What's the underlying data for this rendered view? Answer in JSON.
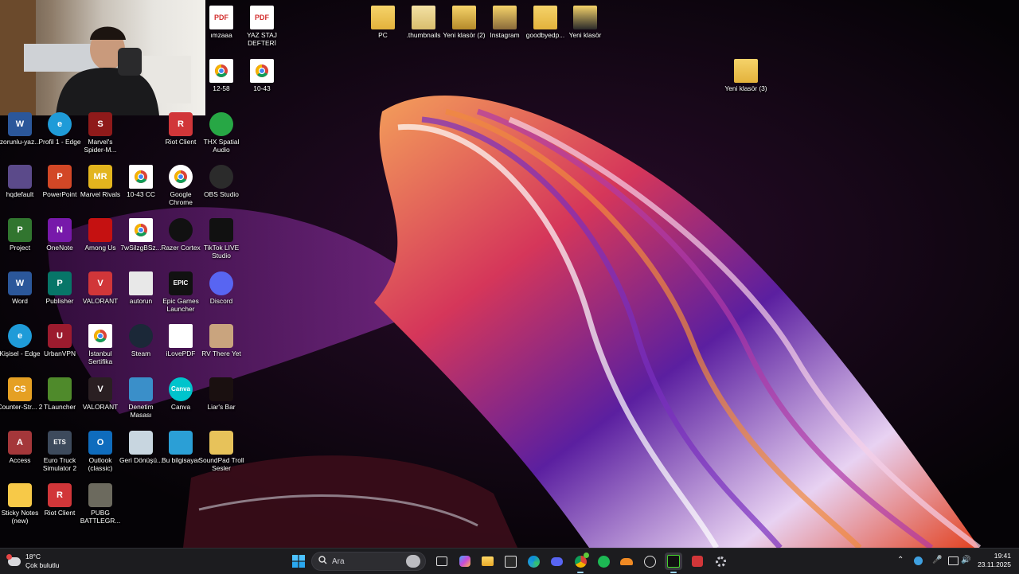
{
  "desktop": {
    "top_icons": [
      {
        "label": "ımzaaa",
        "icon": "pdf-icon"
      },
      {
        "label": "YAZ STAJ DEFTERİ",
        "icon": "pdf-icon"
      },
      {
        "label": "12-58",
        "icon": "chrome-file-icon"
      },
      {
        "label": "10-43",
        "icon": "chrome-file-icon"
      }
    ],
    "folders": [
      {
        "label": "PC"
      },
      {
        "label": ".thumbnails"
      },
      {
        "label": "Yeni klasör (2)"
      },
      {
        "label": "Instagram"
      },
      {
        "label": "goodbyedp..."
      },
      {
        "label": "Yeni klasör"
      },
      {
        "label": "Yeni klasör (3)"
      }
    ],
    "grid": [
      [
        {
          "label": "zorunlu-yaz...",
          "icon": "word-icon",
          "color": "#2b579a",
          "glyph": "W"
        },
        {
          "label": "hqdefault",
          "icon": "image-icon",
          "color": "#5b4a8a",
          "glyph": ""
        },
        {
          "label": "Project",
          "icon": "project-icon",
          "color": "#31752f",
          "glyph": "P"
        },
        {
          "label": "Word",
          "icon": "word-icon",
          "color": "#2b579a",
          "glyph": "W"
        },
        {
          "label": "Kişisel - Edge",
          "icon": "edge-icon",
          "color": "#1f9bd8",
          "glyph": "e"
        },
        {
          "label": "Counter-Str... 2",
          "icon": "cs2-icon",
          "color": "#e5a023",
          "glyph": "CS"
        },
        {
          "label": "Access",
          "icon": "access-icon",
          "color": "#a4373a",
          "glyph": "A"
        },
        {
          "label": "Sticky Notes (new)",
          "icon": "sticky-notes-icon",
          "color": "#f7c948",
          "glyph": ""
        }
      ],
      [
        {
          "label": "Profil 1 - Edge",
          "icon": "edge-icon",
          "color": "#1f9bd8",
          "glyph": "e"
        },
        {
          "label": "PowerPoint",
          "icon": "powerpoint-icon",
          "color": "#d24726",
          "glyph": "P"
        },
        {
          "label": "OneNote",
          "icon": "onenote-icon",
          "color": "#7719aa",
          "glyph": "N"
        },
        {
          "label": "Publisher",
          "icon": "publisher-icon",
          "color": "#077568",
          "glyph": "P"
        },
        {
          "label": "UrbanVPN",
          "icon": "urbanvpn-icon",
          "color": "#9c1b2e",
          "glyph": "U"
        },
        {
          "label": "TLauncher",
          "icon": "tlauncher-icon",
          "color": "#4f8a2b",
          "glyph": ""
        },
        {
          "label": "Euro Truck Simulator 2",
          "icon": "ets2-icon",
          "color": "#3d4a5c",
          "glyph": "ETS"
        },
        {
          "label": "Riot Client",
          "icon": "riot-icon",
          "color": "#d13639",
          "glyph": "R"
        }
      ],
      [
        {
          "label": "Marvel's Spider-M...",
          "icon": "spiderman-icon",
          "color": "#8f1a1a",
          "glyph": "S"
        },
        {
          "label": "Marvel Rivals",
          "icon": "marvel-rivals-icon",
          "color": "#e3b51e",
          "glyph": "MR"
        },
        {
          "label": "Among Us",
          "icon": "among-us-icon",
          "color": "#c51111",
          "glyph": ""
        },
        {
          "label": "VALORANT",
          "icon": "riot-icon",
          "color": "#d13639",
          "glyph": "V"
        },
        {
          "label": "İstanbul Sertifika",
          "icon": "chrome-file-icon",
          "color": "#ffffff",
          "glyph": ""
        },
        {
          "label": "VALORANT",
          "icon": "valorant-icon",
          "color": "#2a1f22",
          "glyph": "V"
        },
        {
          "label": "Outlook (classic)",
          "icon": "outlook-icon",
          "color": "#0f6cbd",
          "glyph": "O"
        },
        {
          "label": "PUBG BATTLEGR...",
          "icon": "pubg-icon",
          "color": "#6c6a5e",
          "glyph": ""
        }
      ],
      [
        {
          "label": "",
          "icon": "",
          "color": "",
          "glyph": ""
        },
        {
          "label": "10-43 CC",
          "icon": "chrome-file-icon",
          "color": "#ffffff",
          "glyph": ""
        },
        {
          "label": "7wSilzgBSz...",
          "icon": "chrome-file-icon",
          "color": "#ffffff",
          "glyph": ""
        },
        {
          "label": "autorun",
          "icon": "settings-file-icon",
          "color": "#e8e8e8",
          "glyph": ""
        },
        {
          "label": "Steam",
          "icon": "steam-icon",
          "color": "#1b2838",
          "glyph": ""
        },
        {
          "label": "Denetim Masası",
          "icon": "control-panel-icon",
          "color": "#3a8fc9",
          "glyph": ""
        },
        {
          "label": "Geri Dönüşü...",
          "icon": "recycle-bin-icon",
          "color": "#c8d6e0",
          "glyph": ""
        },
        {
          "label": "",
          "icon": "",
          "color": "",
          "glyph": ""
        }
      ],
      [
        {
          "label": "Riot Client",
          "icon": "riot-icon",
          "color": "#d13639",
          "glyph": "R"
        },
        {
          "label": "Google Chrome",
          "icon": "chrome-icon",
          "color": "#ffffff",
          "glyph": ""
        },
        {
          "label": "Razer Cortex",
          "icon": "razer-icon",
          "color": "#111111",
          "glyph": ""
        },
        {
          "label": "Epic Games Launcher",
          "icon": "epic-games-icon",
          "color": "#111111",
          "glyph": "EPIC"
        },
        {
          "label": "iLovePDF",
          "icon": "blank-file-icon",
          "color": "#ffffff",
          "glyph": ""
        },
        {
          "label": "Canva",
          "icon": "canva-icon",
          "color": "#00c4cc",
          "glyph": "Canva"
        },
        {
          "label": "Bu bilgisayar",
          "icon": "this-pc-icon",
          "color": "#2b9fd6",
          "glyph": ""
        },
        {
          "label": "",
          "icon": "",
          "color": "",
          "glyph": ""
        }
      ],
      [
        {
          "label": "THX Spatial Audio",
          "icon": "thx-icon",
          "color": "#27a745",
          "glyph": ""
        },
        {
          "label": "OBS Studio",
          "icon": "obs-icon",
          "color": "#2b2b2b",
          "glyph": ""
        },
        {
          "label": "TikTok LIVE Studio",
          "icon": "tiktok-icon",
          "color": "#111111",
          "glyph": ""
        },
        {
          "label": "Discord",
          "icon": "discord-icon",
          "color": "#5865f2",
          "glyph": ""
        },
        {
          "label": "RV There Yet",
          "icon": "rv-there-yet-icon",
          "color": "#c9a47e",
          "glyph": ""
        },
        {
          "label": "Liar's Bar",
          "icon": "liars-bar-icon",
          "color": "#1a1010",
          "glyph": ""
        },
        {
          "label": "SoundPad Troll Sesler",
          "icon": "folder-icon",
          "color": "#e7c25a",
          "glyph": ""
        },
        {
          "label": "",
          "icon": "",
          "color": "",
          "glyph": ""
        }
      ]
    ]
  },
  "taskbar": {
    "weather_temp": "18°C",
    "weather_desc": "Çok bulutlu",
    "search_placeholder": "Ara",
    "time": "19:41",
    "date": "23.11.2025",
    "accent": "#9ad3ff"
  }
}
